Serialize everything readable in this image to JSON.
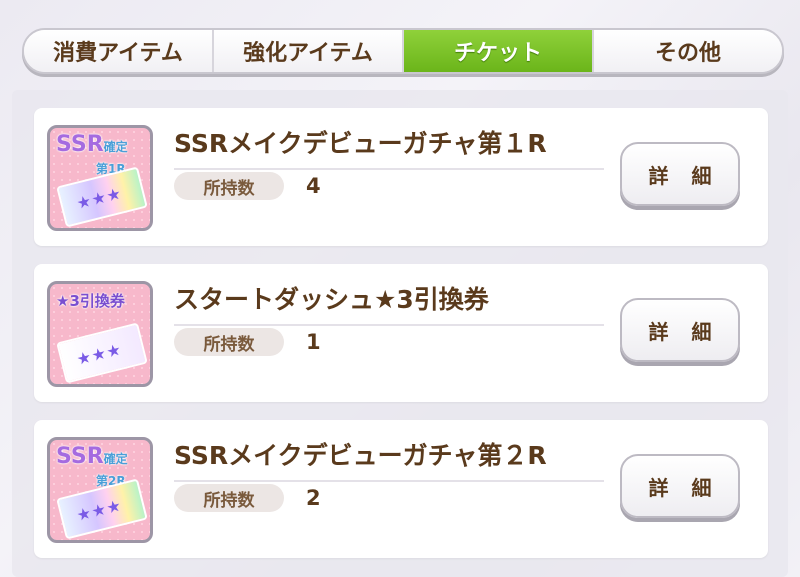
{
  "tabs": [
    {
      "label": "消費アイテム"
    },
    {
      "label": "強化アイテム"
    },
    {
      "label": "チケット"
    },
    {
      "label": "その他"
    }
  ],
  "active_tab": "チケット",
  "items": [
    {
      "title": "SSRメイクデビューガチャ第１R",
      "owned_label": "所持数",
      "owned_count": "4",
      "detail_label": "詳 細",
      "thumb_top": "SSR",
      "thumb_sub": "確定",
      "thumb_sub2": "第1R"
    },
    {
      "title": "スタートダッシュ★3引換券",
      "owned_label": "所持数",
      "owned_count": "1",
      "detail_label": "詳 細",
      "thumb_top": "★3引換券",
      "thumb_sub": "",
      "thumb_sub2": ""
    },
    {
      "title": "SSRメイクデビューガチャ第２R",
      "owned_label": "所持数",
      "owned_count": "2",
      "detail_label": "詳 細",
      "thumb_top": "SSR",
      "thumb_sub": "確定",
      "thumb_sub2": "第2R"
    }
  ],
  "colors": {
    "active_tab": "#7cc428",
    "text_brown": "#5a3a1c",
    "card_bg": "#ffffff"
  }
}
